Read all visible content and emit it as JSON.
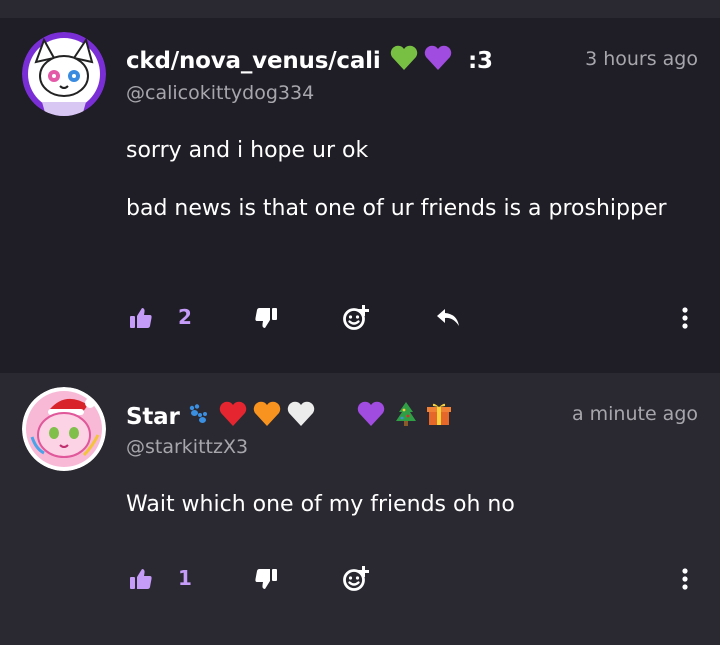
{
  "comments": [
    {
      "display_name": "ckd/nova_venus/cali",
      "name_suffix": ":3",
      "name_emojis": [
        "green-heart",
        "purple-heart"
      ],
      "handle": "@calicokittydog334",
      "timestamp": "3 hours ago",
      "paragraphs": [
        "sorry and i hope ur ok",
        "bad news is that one of ur friends is a proshipper"
      ],
      "like_count": "2"
    },
    {
      "display_name": "Star",
      "name_emojis": [
        "paw-prints",
        "red-heart",
        "orange-heart",
        "white-heart",
        "purple-heart",
        "christmas-tree",
        "gift"
      ],
      "handle": "@starkittzX3",
      "timestamp": "a minute ago",
      "paragraphs": [
        "Wait which one of my friends oh no"
      ],
      "like_count": "1"
    }
  ],
  "colors": {
    "accent": "#c59cf7",
    "background": "#1f1d25",
    "background_alt": "#2a2830",
    "muted_text": "#a8a6ad"
  },
  "icons": [
    "thumbs-up-icon",
    "thumbs-down-icon",
    "add-reaction-icon",
    "reply-icon",
    "more-vertical-icon"
  ]
}
